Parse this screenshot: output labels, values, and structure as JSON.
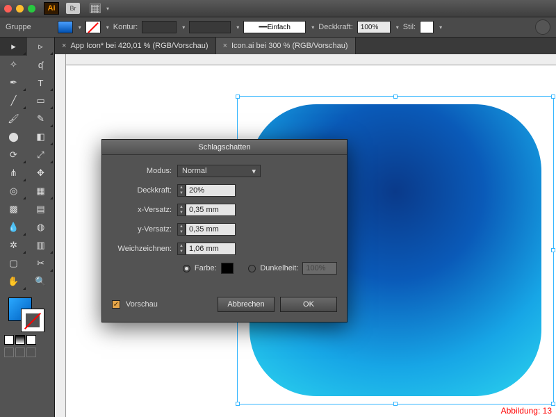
{
  "titlebar": {
    "app_abbr": "Ai",
    "br": "Br"
  },
  "controlbar": {
    "group_label": "Gruppe",
    "stroke_label": "Kontur:",
    "stroke_style": "Einfach",
    "opacity_label": "Deckkraft:",
    "opacity_value": "100%",
    "style_label": "Stil:"
  },
  "doc_tabs": [
    {
      "label": "App Icon* bei 420,01 % (RGB/Vorschau)"
    },
    {
      "label": "Icon.ai bei 300 % (RGB/Vorschau)"
    }
  ],
  "dialog": {
    "title": "Schlagschatten",
    "mode_label": "Modus:",
    "mode_value": "Normal",
    "opacity_label": "Deckkraft:",
    "opacity_value": "20%",
    "x_label": "x-Versatz:",
    "x_value": "0,35 mm",
    "y_label": "y-Versatz:",
    "y_value": "0,35 mm",
    "blur_label": "Weichzeichnen:",
    "blur_value": "1,06 mm",
    "color_label": "Farbe:",
    "darkness_label": "Dunkelheit:",
    "darkness_value": "100%",
    "preview_label": "Vorschau",
    "cancel": "Abbrechen",
    "ok": "OK"
  },
  "figure_caption": "Abbildung: 13"
}
